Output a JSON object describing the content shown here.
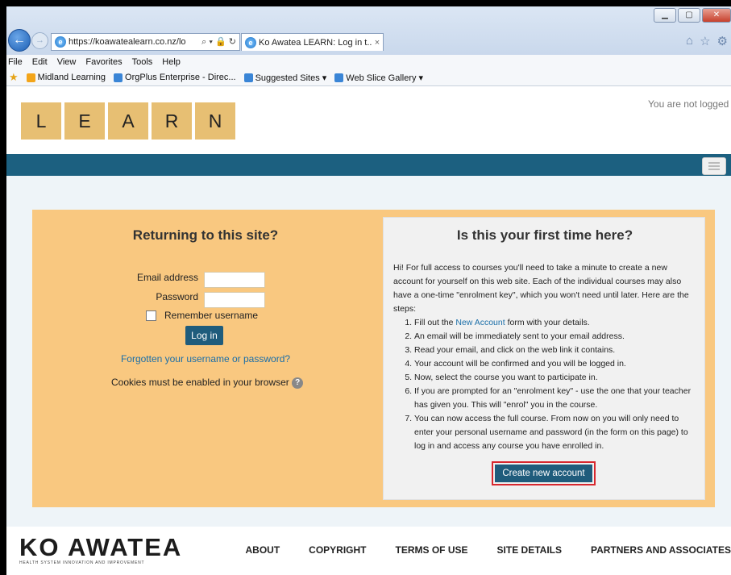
{
  "browser": {
    "address": "https://koawatealearn.co.nz/lo",
    "address_tools": "⌕ ▾ 🔒 ↻",
    "tab_title": "Ko Awatea LEARN: Log in t...",
    "tab_close": "×",
    "menu": [
      "File",
      "Edit",
      "View",
      "Favorites",
      "Tools",
      "Help"
    ],
    "favorites": [
      {
        "label": "Midland Learning",
        "color": "#f3a51a"
      },
      {
        "label": "OrgPlus Enterprise - Direc...",
        "color": "#3a85d6"
      },
      {
        "label": "Suggested Sites ▾",
        "color": "#3a85d6"
      },
      {
        "label": "Web Slice Gallery ▾",
        "color": "#3a85d6"
      }
    ]
  },
  "header": {
    "logo_letters": [
      "L",
      "E",
      "A",
      "R",
      "N"
    ],
    "login_status": "You are not logged in"
  },
  "login": {
    "title": "Returning to this site?",
    "email_label": "Email address",
    "password_label": "Password",
    "remember_label": "Remember username",
    "login_button": "Log in",
    "forgot_link": "Forgotten your username or password?",
    "cookies_text": "Cookies must be enabled in your browser",
    "help_glyph": "?"
  },
  "signup": {
    "title": "Is this your first time here?",
    "intro": "Hi! For full access to courses you'll need to take a minute to create a new account for yourself on this web site. Each of the individual courses may also have a one-time \"enrolment key\", which you won't need until later. Here are the steps:",
    "step1_prefix": "Fill out the ",
    "step1_link": "New Account",
    "step1_suffix": " form with your details.",
    "steps": [
      "An email will be immediately sent to your email address.",
      "Read your email, and click on the web link it contains.",
      "Your account will be confirmed and you will be logged in.",
      "Now, select the course you want to participate in.",
      "If you are prompted for an \"enrolment key\" - use the one that your teacher has given you. This will \"enrol\" you in the course.",
      "You can now access the full course. From now on you will only need to enter your personal username and password (in the form on this page) to log in and access any course you have enrolled in."
    ],
    "create_button": "Create new account"
  },
  "footer": {
    "logo_main": "KO AWATEA",
    "logo_sub": "HEALTH SYSTEM INNOVATION AND IMPROVEMENT",
    "links": [
      "ABOUT",
      "COPYRIGHT",
      "TERMS OF USE",
      "SITE DETAILS",
      "PARTNERS AND ASSOCIATES"
    ]
  },
  "colors": {
    "navbar": "#1c6080",
    "panel": "#f9c880",
    "logo_tile": "#e7bf73",
    "button": "#1f5c7c",
    "highlight": "#d7282f"
  }
}
